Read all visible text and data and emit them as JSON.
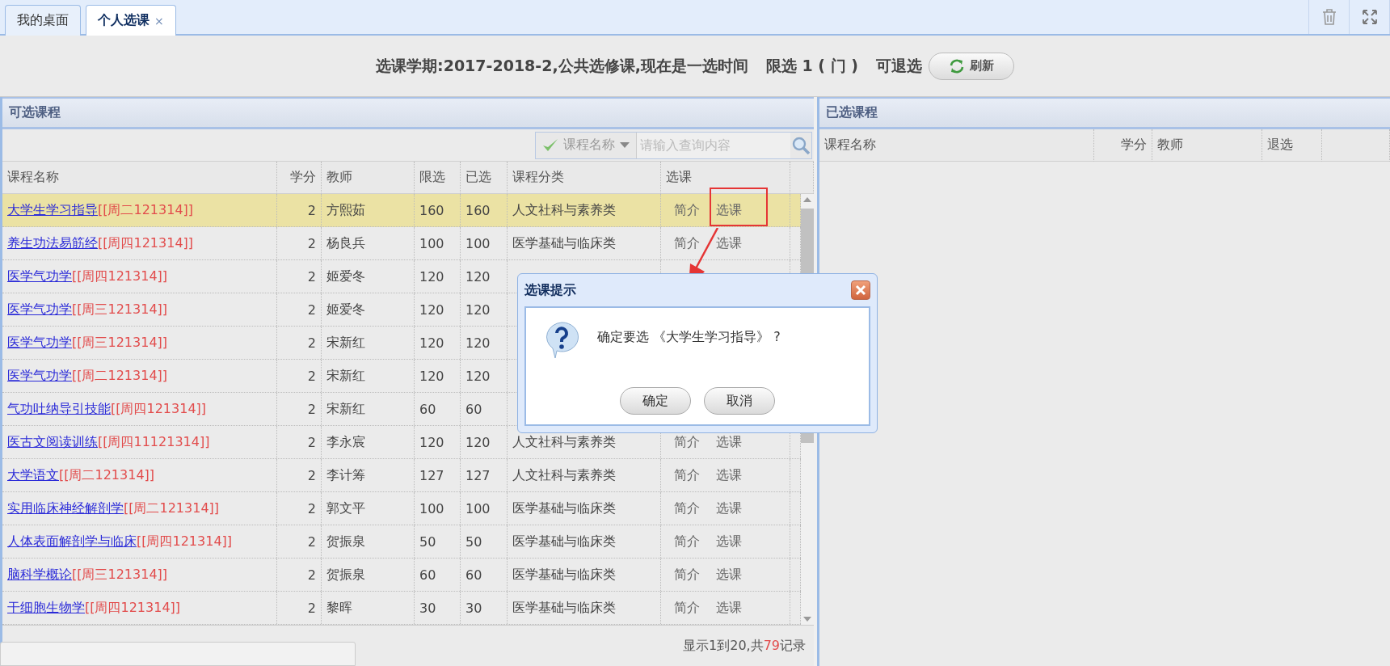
{
  "tabs": [
    {
      "label": "我的桌面",
      "selected": false
    },
    {
      "label": "个人选课",
      "selected": true,
      "close": "×"
    }
  ],
  "header": {
    "term": "选课学期:2017-2018-2,公共选修课,现在是一选时间",
    "limit": "限选 1 ( 门 )",
    "withdraw": "可退选",
    "refresh": "刷新"
  },
  "available": {
    "title": "可选课程",
    "filter": {
      "field": "课程名称",
      "placeholder": "请输入查询内容"
    },
    "columns": [
      "课程名称",
      "学分",
      "教师",
      "限选",
      "已选",
      "课程分类",
      "选课"
    ],
    "rows": [
      {
        "name": "大学生学习指导",
        "time": "[[周二121314]]",
        "credit": "2",
        "teacher": "方熙茹",
        "limit": "160",
        "chosen": "160",
        "category": "人文社科与素养类",
        "intro": "简介",
        "pick": "选课",
        "selected": true
      },
      {
        "name": "养生功法易筋经",
        "time": "[[周四121314]]",
        "credit": "2",
        "teacher": "杨良兵",
        "limit": "100",
        "chosen": "100",
        "category": "医学基础与临床类",
        "intro": "简介",
        "pick": "选课",
        "selected": false
      },
      {
        "name": "医学气功学",
        "time": "[[周四121314]]",
        "credit": "2",
        "teacher": "姬爱冬",
        "limit": "120",
        "chosen": "120",
        "selected": false
      },
      {
        "name": "医学气功学",
        "time": "[[周三121314]]",
        "credit": "2",
        "teacher": "姬爱冬",
        "limit": "120",
        "chosen": "120",
        "selected": false
      },
      {
        "name": "医学气功学",
        "time": "[[周三121314]]",
        "credit": "2",
        "teacher": "宋新红",
        "limit": "120",
        "chosen": "120",
        "selected": false
      },
      {
        "name": "医学气功学",
        "time": "[[周二121314]]",
        "credit": "2",
        "teacher": "宋新红",
        "limit": "120",
        "chosen": "120",
        "selected": false
      },
      {
        "name": "气功吐纳导引技能",
        "time": "[[周四121314]]",
        "credit": "2",
        "teacher": "宋新红",
        "limit": "60",
        "chosen": "60",
        "selected": false
      },
      {
        "name": "医古文阅读训练",
        "time": "[[周四11121314]]",
        "credit": "2",
        "teacher": "李永宸",
        "limit": "120",
        "chosen": "120",
        "category": "人文社科与素养类",
        "intro": "简介",
        "pick": "选课",
        "selected": false
      },
      {
        "name": "大学语文",
        "time": "[[周二121314]]",
        "credit": "2",
        "teacher": "李计筹",
        "limit": "127",
        "chosen": "127",
        "category": "人文社科与素养类",
        "intro": "简介",
        "pick": "选课",
        "selected": false
      },
      {
        "name": "实用临床神经解剖学",
        "time": "[[周二121314]]",
        "credit": "2",
        "teacher": "郭文平",
        "limit": "100",
        "chosen": "100",
        "category": "医学基础与临床类",
        "intro": "简介",
        "pick": "选课",
        "selected": false
      },
      {
        "name": "人体表面解剖学与临床",
        "time": "[[周四121314]]",
        "credit": "2",
        "teacher": "贺振泉",
        "limit": "50",
        "chosen": "50",
        "category": "医学基础与临床类",
        "intro": "简介",
        "pick": "选课",
        "selected": false
      },
      {
        "name": "脑科学概论",
        "time": "[[周三121314]]",
        "credit": "2",
        "teacher": "贺振泉",
        "limit": "60",
        "chosen": "60",
        "category": "医学基础与临床类",
        "intro": "简介",
        "pick": "选课",
        "selected": false
      },
      {
        "name": "干细胞生物学",
        "time": "[[周四121314]]",
        "credit": "2",
        "teacher": "黎晖",
        "limit": "30",
        "chosen": "30",
        "category": "医学基础与临床类",
        "intro": "简介",
        "pick": "选课",
        "selected": false
      }
    ],
    "status": {
      "prefix": "显示1到20,共",
      "count": "79",
      "suffix": "记录"
    }
  },
  "chosen": {
    "title": "已选课程",
    "columns": [
      "课程名称",
      "学分",
      "教师",
      "退选"
    ]
  },
  "dialog": {
    "title": "选课提示",
    "message": "确定要选 《大学生学习指导》 ?",
    "buttons": [
      "确定",
      "取消"
    ]
  }
}
